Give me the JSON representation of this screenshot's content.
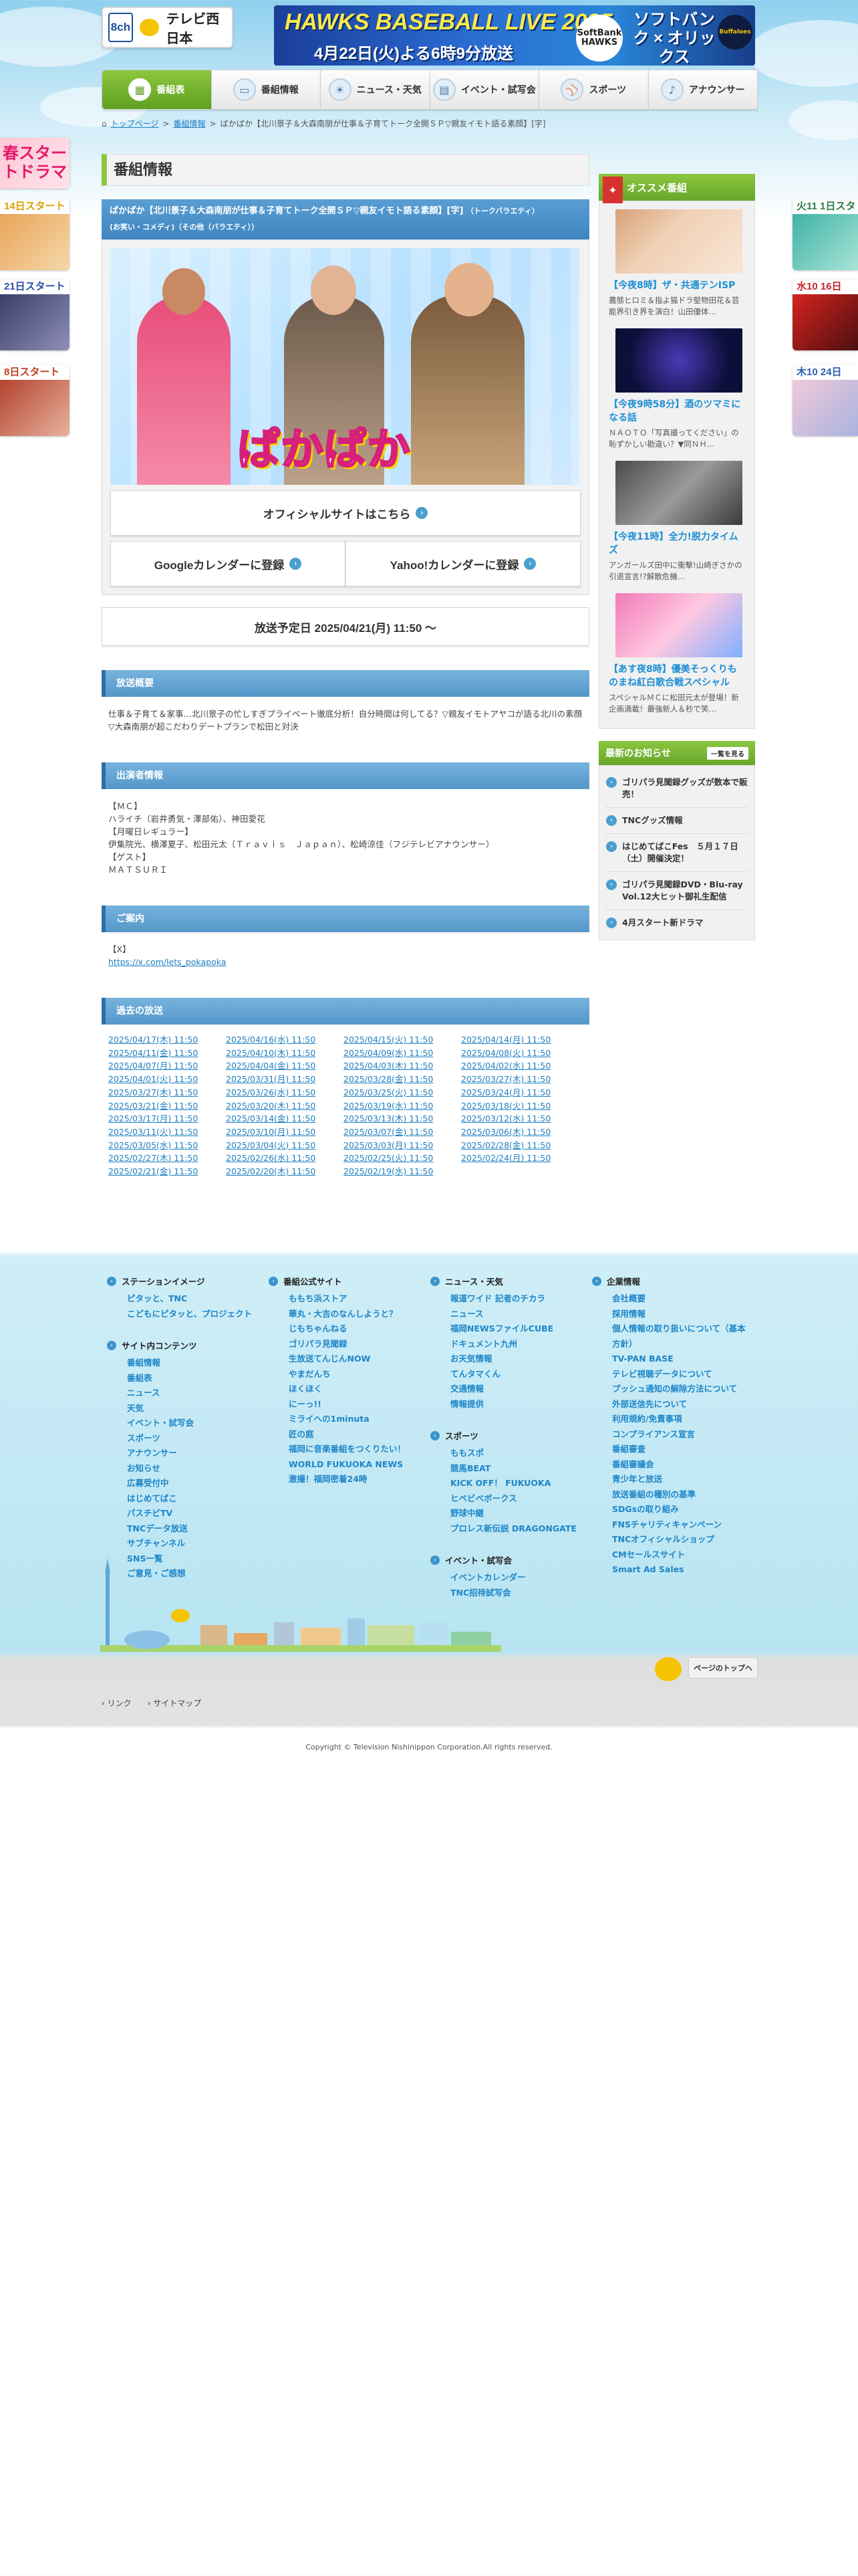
{
  "header": {
    "channel": "8ch",
    "logo": "テレビ西日本",
    "banner": {
      "line1": "HAWKS BASEBALL LIVE 2025",
      "line2": "4月22日(火)よる6時9分放送",
      "team1": "SoftBank HAWKS",
      "line3": "ソフトバンク × オリックス",
      "team2": "Buffaloes"
    }
  },
  "nav": [
    {
      "label": "番組表",
      "icon": "tv-guide-icon"
    },
    {
      "label": "番組情報",
      "icon": "tv-icon"
    },
    {
      "label": "ニュース・天気",
      "icon": "news-icon"
    },
    {
      "label": "イベント・試写会",
      "icon": "calendar-icon"
    },
    {
      "label": "スポーツ",
      "icon": "sports-icon"
    },
    {
      "label": "アナウンサー",
      "icon": "microphone-icon"
    }
  ],
  "breadcrumb": {
    "home": "トップページ",
    "sep": ">",
    "category": "番組情報",
    "current": "ぱかぱか【北川景子＆大森南朋が仕事＆子育てトーク全開ＳＰ▽親友イモト語る素顔】[字]"
  },
  "left_ads": [
    {
      "headline": "春スタートドラマ"
    },
    {
      "date": "14日スタート"
    },
    {
      "date": "21日スタート"
    },
    {
      "date": "8日スタート"
    }
  ],
  "right_ads": [
    {
      "date": "火11 1日スタ"
    },
    {
      "date": "水10 16日"
    },
    {
      "date": "木10 24日"
    }
  ],
  "page_title": "番組情報",
  "program": {
    "title": "ぱかぱか【北川景子＆大森南朋が仕事＆子育てトーク全開ＳＰ▽親友イモト語る素顔】[字]",
    "genre1": "（トークバラエティ）",
    "genre2": "(お笑い・コメディ)（その他（バラエティ））",
    "hero_logo": "ぱかぱか",
    "official_btn": "オフィシャルサイトはこちら",
    "google_btn": "Googleカレンダーに登録",
    "yahoo_btn": "Yahoo!カレンダーに登録",
    "air_date": "放送予定日 2025/04/21(月) 11:50 〜"
  },
  "sections": {
    "summary": {
      "title": "放送概要",
      "body": "仕事＆子育て＆家事…北川景子の忙しすぎプライベート徹底分析！自分時間は何してる？▽親友イモトアヤコが語る北川の素顔▽大森南朋が超こだわりデートプランで松田と対決"
    },
    "cast": {
      "title": "出演者情報",
      "lines": [
        "【ＭＣ】",
        "ハライチ（岩井勇気・澤部佑）、神田愛花",
        "【月曜日レギュラー】",
        "伊集院光、横澤夏子、松田元太（Ｔｒａｖｉｓ　Ｊａｐａｎ）、松崎涼佳（フジテレビアナウンサー）",
        "【ゲスト】",
        "ＭＡＴＳＵＲＩ"
      ]
    },
    "guide": {
      "title": "ご案内",
      "label": "【X】",
      "link": "https://x.com/lets_pokapoka"
    },
    "past": {
      "title": "過去の放送",
      "dates": [
        "2025/04/17(木) 11:50",
        "2025/04/16(水) 11:50",
        "2025/04/15(火) 11:50",
        "2025/04/14(月) 11:50",
        "2025/04/11(金) 11:50",
        "2025/04/10(木) 11:50",
        "2025/04/09(水) 11:50",
        "2025/04/08(火) 11:50",
        "2025/04/07(月) 11:50",
        "2025/04/04(金) 11:50",
        "2025/04/03(木) 11:50",
        "2025/04/02(水) 11:50",
        "2025/04/01(火) 11:50",
        "2025/03/31(月) 11:50",
        "2025/03/28(金) 11:50",
        "2025/03/27(木) 11:50",
        "2025/03/27(木) 11:50",
        "2025/03/26(水) 11:50",
        "2025/03/25(火) 11:50",
        "2025/03/24(月) 11:50",
        "2025/03/21(金) 11:50",
        "2025/03/20(木) 11:50",
        "2025/03/19(水) 11:50",
        "2025/03/18(火) 11:50",
        "2025/03/17(月) 11:50",
        "2025/03/14(金) 11:50",
        "2025/03/13(木) 11:50",
        "2025/03/12(水) 11:50",
        "2025/03/11(火) 11:50",
        "2025/03/10(月) 11:50",
        "2025/03/07(金) 11:50",
        "2025/03/06(木) 11:50",
        "2025/03/05(水) 11:50",
        "2025/03/04(火) 11:50",
        "2025/03/03(月) 11:50",
        "2025/02/28(金) 11:50",
        "2025/02/27(木) 11:50",
        "2025/02/26(水) 11:50",
        "2025/02/25(火) 11:50",
        "2025/02/24(月) 11:50",
        "2025/02/21(金) 11:50",
        "2025/02/20(木) 11:50",
        "2025/02/19(水) 11:50"
      ]
    }
  },
  "sidebar": {
    "osusume_title": "オススメ番組",
    "items": [
      {
        "headline": "【今夜8時】ザ・共通テンISP",
        "desc": "農態ヒロミ＆指よ猫ドラ堅物田花＆芸能界引き界を演白！山田優体…"
      },
      {
        "headline": "【今夜9時58分】酒のツマミになる話",
        "desc": "ＮＡＯＴＯ「写真撮ってください」の恥ずかしい勘違い？▼同ＮＨ…"
      },
      {
        "headline": "【今夜11時】全力!脱力タイムズ",
        "desc": "アンガールズ田中に衝撃!山崎ぎさかの引退宣言!?解散危機…"
      },
      {
        "headline": "【あす夜8時】優美そっくりものまね紅白歌合戦スペシャル",
        "desc": "スペシャルＭＣに松田元太が登場！新企画満載！最強新人＆秒で笑…"
      }
    ],
    "news_title": "最新のお知らせ",
    "news_all": "一覧を見る",
    "news": [
      "ゴリパラ見聞録グッズが数本で販売！",
      "TNCグッズ情報",
      "はじめてばこFes　５月１７日（土）開催決定！",
      "ゴリパラ見聞録DVD・Blu-ray Vol.12大ヒット御礼生配信",
      "4月スタート新ドラマ"
    ]
  },
  "footer": {
    "cols": [
      [
        {
          "title": "ステーションイメージ",
          "links": [
            "ピタッと、TNC",
            "こどもにピタッと、プロジェクト"
          ]
        },
        {
          "title": "サイト内コンテンツ",
          "links": [
            "番組情報",
            "番組表",
            "ニュース",
            "天気",
            "イベント・試写会",
            "スポーツ",
            "アナウンサー",
            "お知らせ",
            "広募受付中",
            "はじめてばこ",
            "パスチビTV",
            "TNCデータ放送",
            "サブチャンネル",
            "SNS一覧",
            "ご意見・ご感想"
          ]
        }
      ],
      [
        {
          "title": "番組公式サイト",
          "links": [
            "ももち浜ストア",
            "華丸・大吉のなんしようと？",
            "じもちゃんねる",
            "ゴリパラ見聞録",
            "生放送てんじんNOW",
            "やまだんち",
            "ほくほく",
            "にーっ!!",
            "ミライへの1minuta",
            "匠の庭",
            "福岡に音楽番組をつくりたい！",
            "WORLD FUKUOKA NEWS",
            "激撮！福岡密着24時"
          ]
        }
      ],
      [
        {
          "title": "ニュース・天気",
          "links": [
            "報道ワイド 記者のチカラ",
            "ニュース",
            "福岡NEWSファイルCUBE",
            "ドキュメント九州",
            "お天気情報",
            "てんタマくん",
            "交通情報",
            "情報提供"
          ]
        },
        {
          "title": "スポーツ",
          "links": [
            "ももスポ",
            "競馬BEAT",
            "KICK OFF！ FUKUOKA",
            "ヒベビベボークス",
            "野球中継",
            "プロレス新伝説 DRAGONGATE"
          ]
        },
        {
          "title": "イベント・試写会",
          "links": [
            "イベントカレンダー",
            "TNC招待試写会"
          ]
        }
      ],
      [
        {
          "title": "企業情報",
          "links": [
            "会社概要",
            "採用情報",
            "個人情報の取り扱いについて（基本方針）",
            "TV-PAN BASE",
            "テレビ視聴データについて",
            "プッシュ通知の解除方法について",
            "外部送信先について",
            "利用規約/免責事項",
            "コンプライアンス宣言",
            "番組審査",
            "番組審議会",
            "青少年と放送",
            "放送番組の種別の基準",
            "SDGsの取り組み",
            "FNSチャリティキャンペーン",
            "TNCオフィシャルショップ",
            "CMセールスサイト",
            "Smart Ad Sales"
          ]
        }
      ]
    ],
    "pagetop": "ページのトップへ",
    "sublinks": [
      "リンク",
      "サイトマップ"
    ],
    "copyright": "Copyright © Television Nishinippon Corporation.All rights reserved."
  },
  "colors": {
    "accent_green": "#8cc63f",
    "link_blue": "#1d7fc1",
    "section_blue": "#5597c9"
  }
}
